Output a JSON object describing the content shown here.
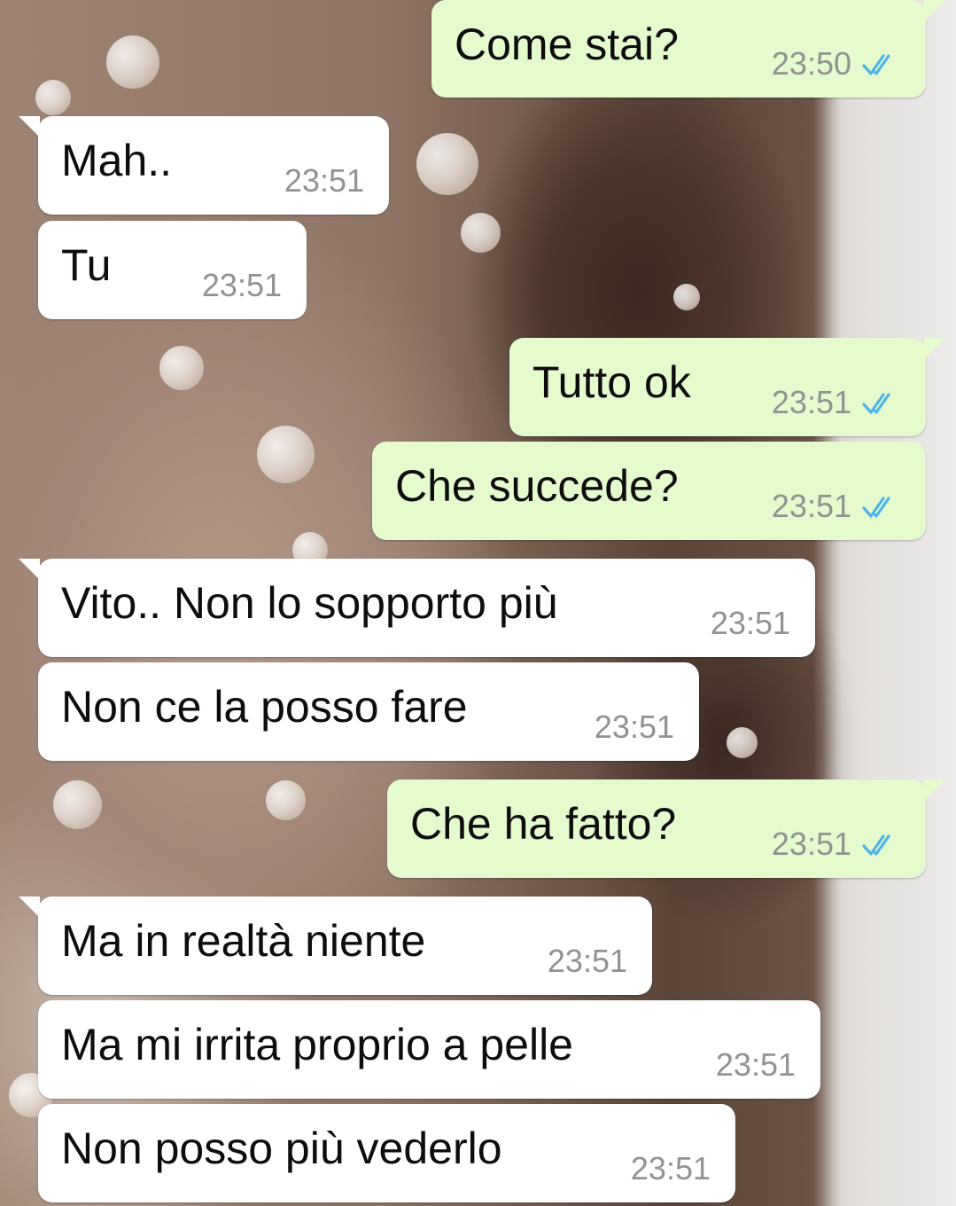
{
  "colors": {
    "incoming_bubble": "#ffffff",
    "outgoing_bubble": "#e5fbce",
    "text": "#0d0d0d",
    "timestamp": "#8f948f",
    "read_ticks": "#4fb3e8"
  },
  "messages": [
    {
      "direction": "outgoing",
      "text": "Come stai?",
      "time": "23:50",
      "status": "read",
      "status_icon": "double-check-icon"
    },
    {
      "direction": "incoming",
      "text": "Mah..",
      "time": "23:51"
    },
    {
      "direction": "incoming",
      "text": "Tu",
      "time": "23:51"
    },
    {
      "direction": "outgoing",
      "text": "Tutto ok",
      "time": "23:51",
      "status": "read",
      "status_icon": "double-check-icon"
    },
    {
      "direction": "outgoing",
      "text": "Che succede?",
      "time": "23:51",
      "status": "read",
      "status_icon": "double-check-icon"
    },
    {
      "direction": "incoming",
      "text": "Vito.. Non lo sopporto più",
      "time": "23:51"
    },
    {
      "direction": "incoming",
      "text": "Non ce la posso fare",
      "time": "23:51"
    },
    {
      "direction": "outgoing",
      "text": "Che ha fatto?",
      "time": "23:51",
      "status": "read",
      "status_icon": "double-check-icon"
    },
    {
      "direction": "incoming",
      "text": "Ma in realtà niente",
      "time": "23:51"
    },
    {
      "direction": "incoming",
      "text": "Ma mi irrita proprio a pelle",
      "time": "23:51"
    },
    {
      "direction": "incoming",
      "text": "Non posso più vederlo",
      "time": "23:51"
    }
  ]
}
